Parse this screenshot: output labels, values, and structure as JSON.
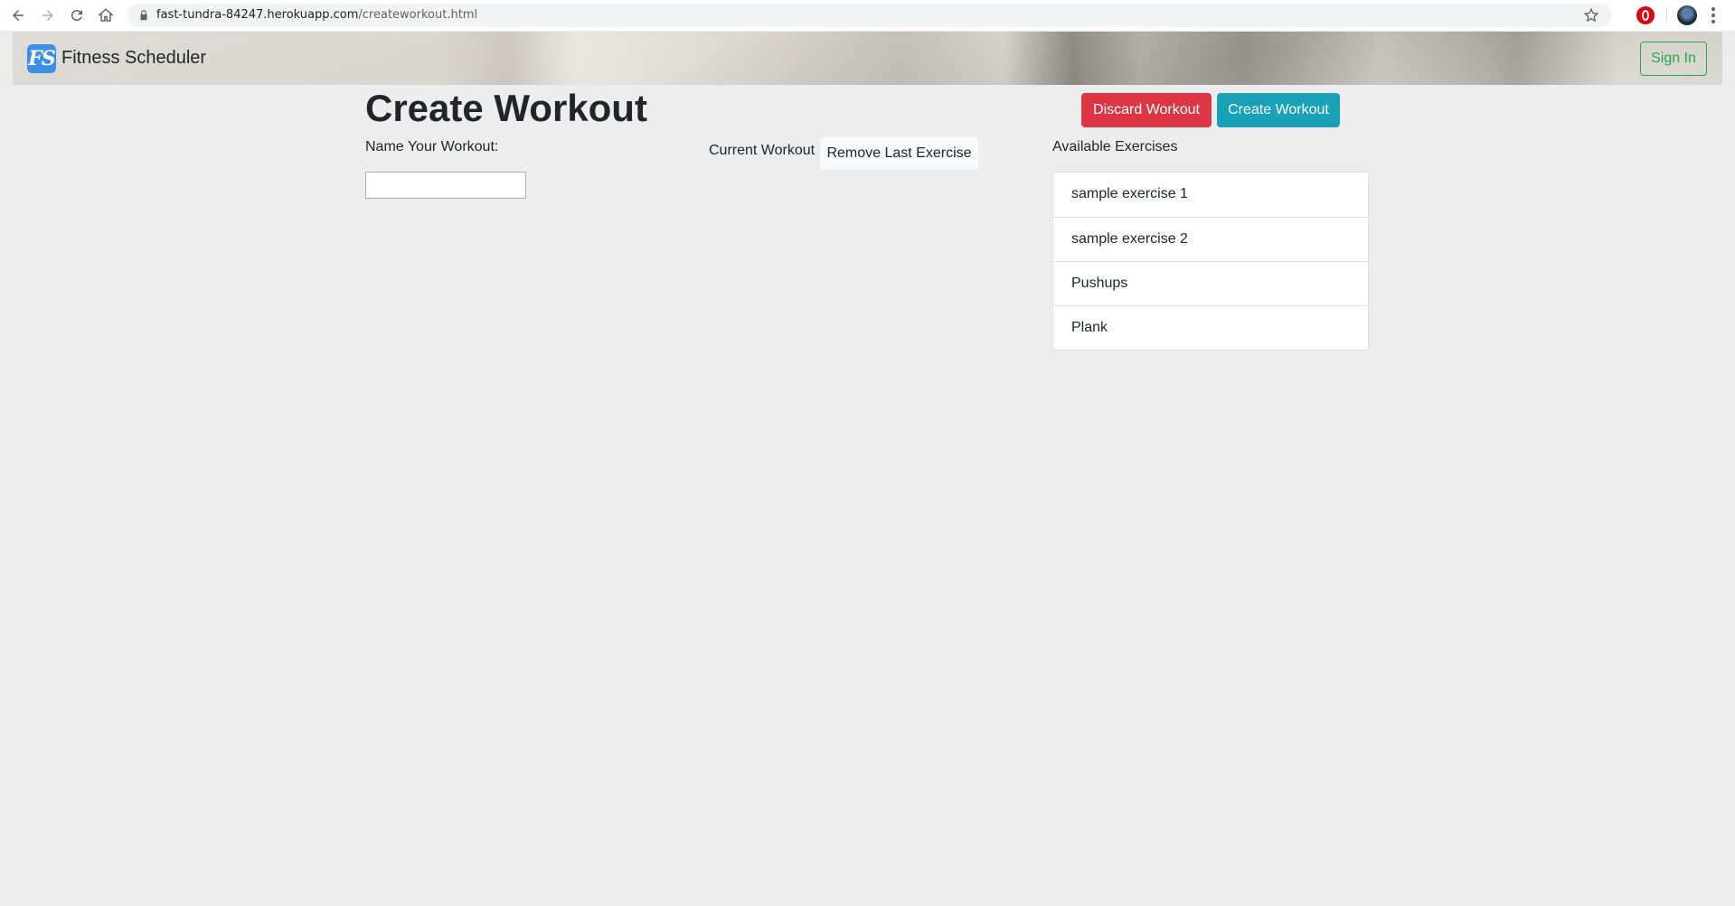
{
  "browser": {
    "url_host": "fast-tundra-84247.herokuapp.com",
    "url_path": "/createworkout.html"
  },
  "navbar": {
    "logo_text": "FS",
    "brand": "Fitness Scheduler",
    "sign_in": "Sign In"
  },
  "page": {
    "title": "Create Workout",
    "discard_button": "Discard Workout",
    "create_button": "Create Workout",
    "name_label": "Name Your Workout:",
    "name_value": "",
    "current_label": "Current Workout",
    "remove_button": "Remove Last Exercise",
    "available_label": "Available Exercises",
    "exercises": [
      "sample exercise 1",
      "sample exercise 2",
      "Pushups",
      "Plank"
    ]
  },
  "colors": {
    "danger": "#dc3545",
    "info": "#17a2b8",
    "success": "#28a745",
    "background": "#ededed"
  }
}
